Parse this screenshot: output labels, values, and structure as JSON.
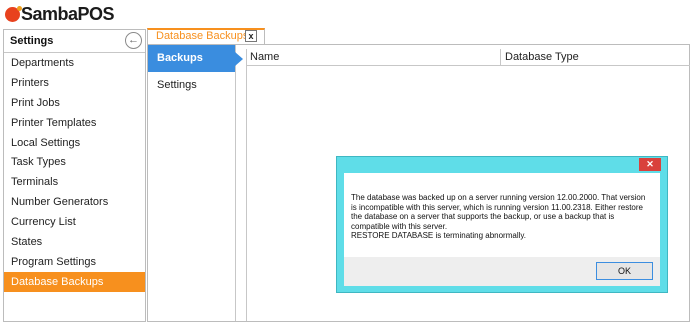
{
  "app": {
    "logo_text": "SambaPOS"
  },
  "left_panel": {
    "title": "Settings",
    "items": [
      {
        "label": "Departments"
      },
      {
        "label": "Printers"
      },
      {
        "label": "Print Jobs"
      },
      {
        "label": "Printer Templates"
      },
      {
        "label": "Local Settings"
      },
      {
        "label": "Task Types"
      },
      {
        "label": "Terminals"
      },
      {
        "label": "Number Generators"
      },
      {
        "label": "Currency List"
      },
      {
        "label": "States"
      },
      {
        "label": "Program Settings"
      },
      {
        "label": "Database Backups",
        "active": true
      }
    ]
  },
  "tab": {
    "label": "Database Backups",
    "close_label": "x"
  },
  "content": {
    "nav": [
      {
        "label": "Backups",
        "active": true
      },
      {
        "label": "Settings"
      }
    ],
    "grid": {
      "columns": [
        "Name",
        "Database Type"
      ]
    }
  },
  "dialog": {
    "close_label": "✕",
    "message_lines": [
      "The database was backed up on a server running version 12.00.2000. That version",
      "is incompatible with this server, which is running version 11.00.2318. Either restore",
      "the database on a server that supports the backup, or use a backup that is",
      "compatible with this server.",
      "RESTORE DATABASE is terminating abnormally."
    ],
    "ok_label": "OK"
  },
  "colors": {
    "accent_orange": "#f7901e",
    "nav_blue": "#3a8ddf",
    "dialog_frame": "#5fdde8",
    "close_red": "#d9413c"
  }
}
